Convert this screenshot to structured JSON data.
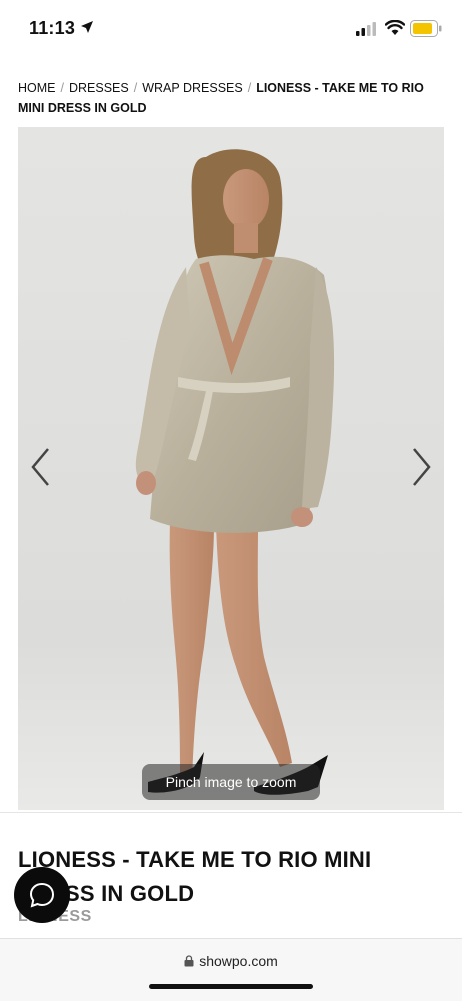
{
  "status_bar": {
    "time": "11:13",
    "battery_color": "#f5c400"
  },
  "breadcrumb": {
    "items": [
      "HOME",
      "DRESSES",
      "WRAP DRESSES"
    ],
    "current": "LIONESS - TAKE ME TO RIO MINI DRESS IN GOLD",
    "separator": "/"
  },
  "gallery": {
    "prev_icon": "chevron-left-icon",
    "next_icon": "chevron-right-icon",
    "zoom_hint": "Pinch image to zoom"
  },
  "product": {
    "title": "LIONESS - TAKE ME TO RIO MINI DRESS IN GOLD",
    "brand": "LIONESS"
  },
  "chat": {
    "icon": "chat-bubble-icon"
  },
  "browser": {
    "url": "showpo.com"
  }
}
